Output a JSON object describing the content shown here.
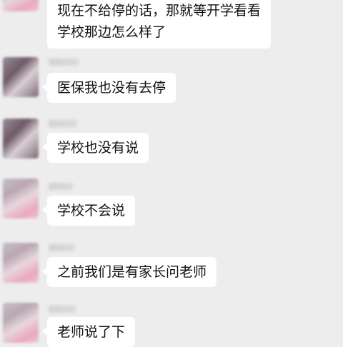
{
  "messages": [
    {
      "lines": [
        "现在不给停的话，那就等开学看看",
        "学校那边怎么样了"
      ]
    },
    {
      "text": "医保我也没有去停"
    },
    {
      "text": "学校也没有说"
    },
    {
      "text": "学校不会说"
    },
    {
      "text": "之前我们是有家长问老师"
    },
    {
      "text": "老师说了下"
    }
  ]
}
